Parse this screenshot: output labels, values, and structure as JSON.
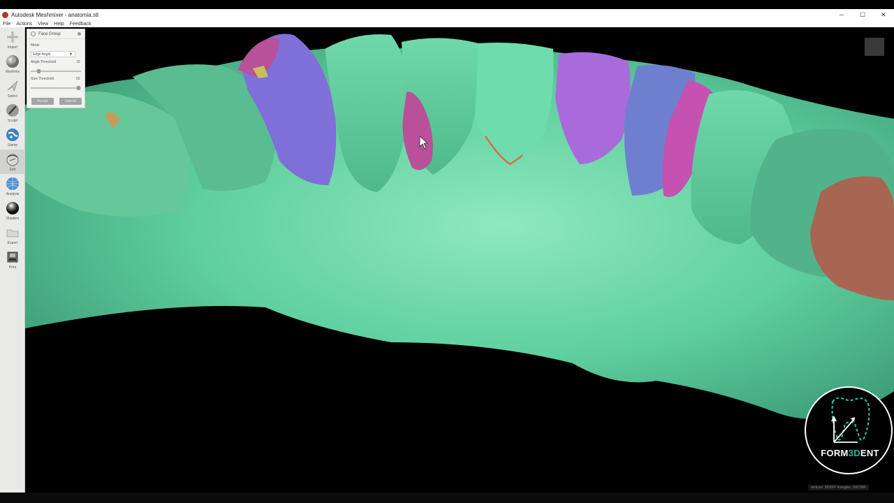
{
  "window": {
    "title": "Autodesk Meshmixer - anatomia.stl",
    "controls": [
      "─",
      "☐",
      "✕"
    ]
  },
  "menu": [
    "File",
    "Actions",
    "View",
    "Help",
    "Feedback"
  ],
  "toolbar": [
    {
      "name": "import",
      "label": "Import",
      "icon": "plus-icon"
    },
    {
      "name": "meshmix",
      "label": "Meshmix",
      "icon": "sphere-icon"
    },
    {
      "name": "select",
      "label": "Select",
      "icon": "arrow-icon"
    },
    {
      "name": "sculpt",
      "label": "Sculpt",
      "icon": "brush-icon"
    },
    {
      "name": "stamp",
      "label": "Stamp",
      "icon": "globe-icon"
    },
    {
      "name": "edit",
      "label": "Edit",
      "icon": "edit-icon",
      "active": true
    },
    {
      "name": "analysis",
      "label": "Analysis",
      "icon": "mesh-sphere-icon"
    },
    {
      "name": "shaders",
      "label": "Shaders",
      "icon": "shader-sphere-icon"
    },
    {
      "name": "export",
      "label": "Export",
      "icon": "folder-icon"
    },
    {
      "name": "print",
      "label": "Print",
      "icon": "printer-icon"
    }
  ],
  "face_group_panel": {
    "title": "Face Group",
    "mode_label": "Mode",
    "mode_value": "Edge Angle",
    "angle_threshold_label": "Angle Threshold",
    "angle_threshold_value": "10",
    "angle_threshold_fraction": 0.14,
    "size_threshold_label": "Size Threshold",
    "size_threshold_value": "50",
    "size_threshold_fraction": 0.98,
    "accept_label": "Accept",
    "cancel_label": "Cancel"
  },
  "status": {
    "mesh_stats": "vertices: 993607 triangles: 1987586"
  },
  "logo": {
    "text_before": "FORM",
    "text_accent": "3D",
    "text_after": "ENT"
  },
  "colors": {
    "mesh_green": "#5fcf9e",
    "group_purple": "#7f6fd9",
    "group_magenta": "#b8509a",
    "group_pink": "#c552b0",
    "group_violet": "#a96bdb",
    "group_blue": "#6f7fd0",
    "group_brown": "#a86552",
    "brand_teal": "#2fb5a8"
  }
}
